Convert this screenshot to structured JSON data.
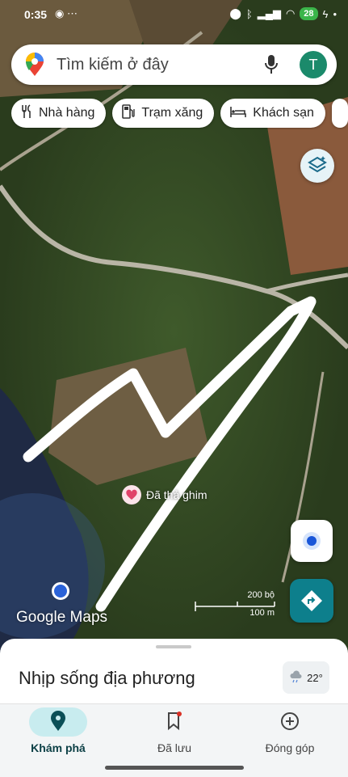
{
  "status": {
    "time": "0:35",
    "battery": "28"
  },
  "search": {
    "placeholder": "Tìm kiếm ở đây",
    "avatar_letter": "T"
  },
  "chips": [
    {
      "label": "Nhà hàng",
      "icon": "fork-knife-icon"
    },
    {
      "label": "Trạm xăng",
      "icon": "gas-station-icon"
    },
    {
      "label": "Khách sạn",
      "icon": "bed-icon"
    }
  ],
  "map": {
    "pin_label": "Đã thả ghim",
    "scale_top": "200 bộ",
    "scale_bottom": "100 m",
    "logo": "Google Maps"
  },
  "sheet": {
    "title": "Nhịp sống địa phương",
    "temperature": "22°"
  },
  "nav": [
    {
      "label": "Khám phá",
      "icon": "explore-pin-icon",
      "active": true
    },
    {
      "label": "Đã lưu",
      "icon": "bookmark-icon",
      "active": false
    },
    {
      "label": "Đóng góp",
      "icon": "plus-circle-icon",
      "active": false
    }
  ],
  "colors": {
    "accent": "#0d7f8c",
    "active_pill": "#c8ecef",
    "avatar": "#1b8a6b"
  }
}
